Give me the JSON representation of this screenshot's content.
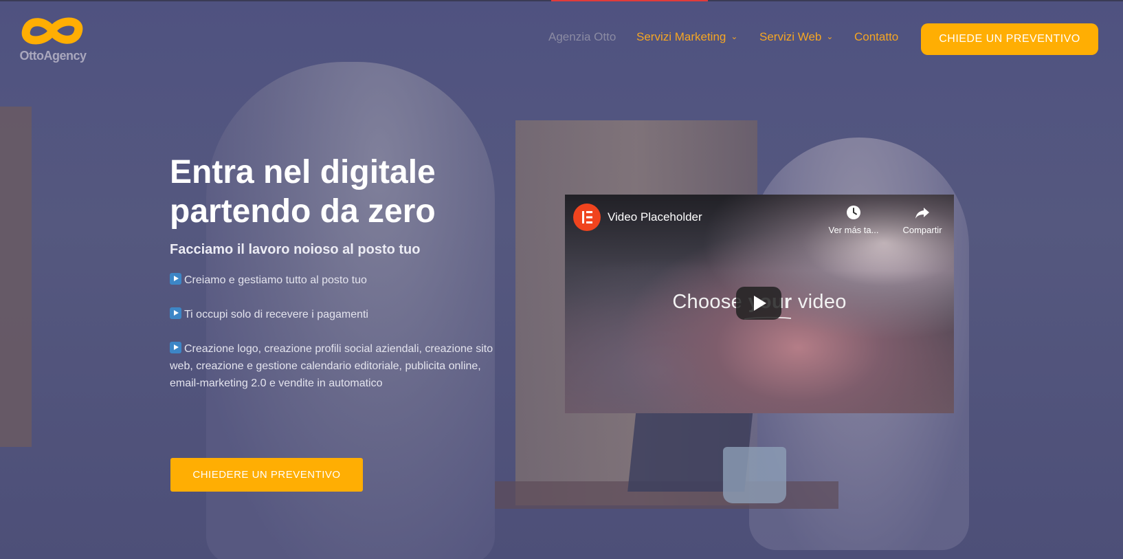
{
  "brand": {
    "name": "OttoAgency",
    "accent": "#ffae03"
  },
  "nav": {
    "items": [
      {
        "label": "Agenzia Otto",
        "has_dropdown": false,
        "state": "current"
      },
      {
        "label": "Servizi Marketing",
        "has_dropdown": true
      },
      {
        "label": "Servizi Web",
        "has_dropdown": true
      },
      {
        "label": "Contatto",
        "has_dropdown": false
      }
    ],
    "cta_label": "CHIEDE UN PREVENTIVO"
  },
  "hero": {
    "title_line1": "Entra nel digitale",
    "title_line2": "partendo da zero",
    "subtitle": "Facciamo il lavoro noioso al posto tuo",
    "bullets": [
      "Creiamo e gestiamo tutto al posto tuo",
      "Ti occupi solo di recevere i pagamenti",
      "Creazione logo, creazione profili social aziendali, creazione sito web, creazione e gestione calendario editoriale, publicita online, email-marketing 2.0 e vendite in automatico"
    ],
    "cta_label": "CHIEDERE UN PREVENTIVO"
  },
  "video": {
    "title": "Video Placeholder",
    "watch_later_label": "Ver más ta...",
    "share_label": "Compartir",
    "overlay_text_before": "Choose ",
    "overlay_text_em": "your",
    "overlay_text_after": " video"
  }
}
